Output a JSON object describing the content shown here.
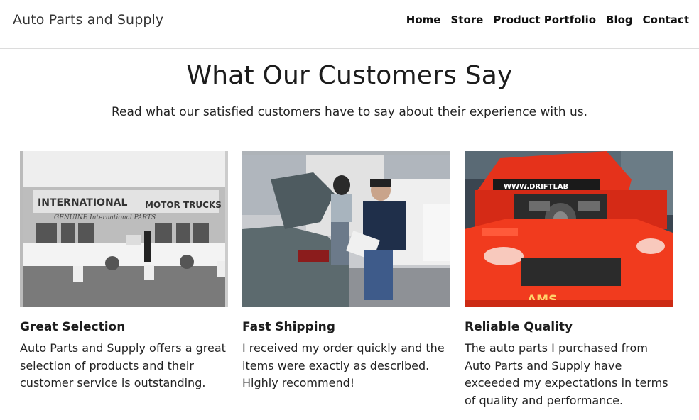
{
  "header": {
    "logo": "Auto Parts and Supply",
    "nav": [
      "Home",
      "Store",
      "Product Portfolio",
      "Blog",
      "Contact"
    ]
  },
  "main": {
    "title": "What Our Customers Say",
    "subtitle": "Read what our satisfied customers have to say about their experience with us."
  },
  "testimonials": [
    {
      "heading": "Great Selection",
      "text": "Auto Parts and Supply offers a great selection of products and their customer service is outstanding."
    },
    {
      "heading": "Fast Shipping",
      "text": "I received my order quickly and the items were exactly as described. Highly recommend!"
    },
    {
      "heading": "Reliable Quality",
      "text": "The auto parts I purchased from Auto Parts and Supply have exceeded my expectations in terms of quality and performance."
    }
  ],
  "photo_text": {
    "sign1": "INTERNATIONAL",
    "sign2": "MOTOR TRUCKS",
    "sign3": "GENUINE International PARTS",
    "hood": "WWW.DRIFTLAB",
    "bumper": "AMS"
  }
}
